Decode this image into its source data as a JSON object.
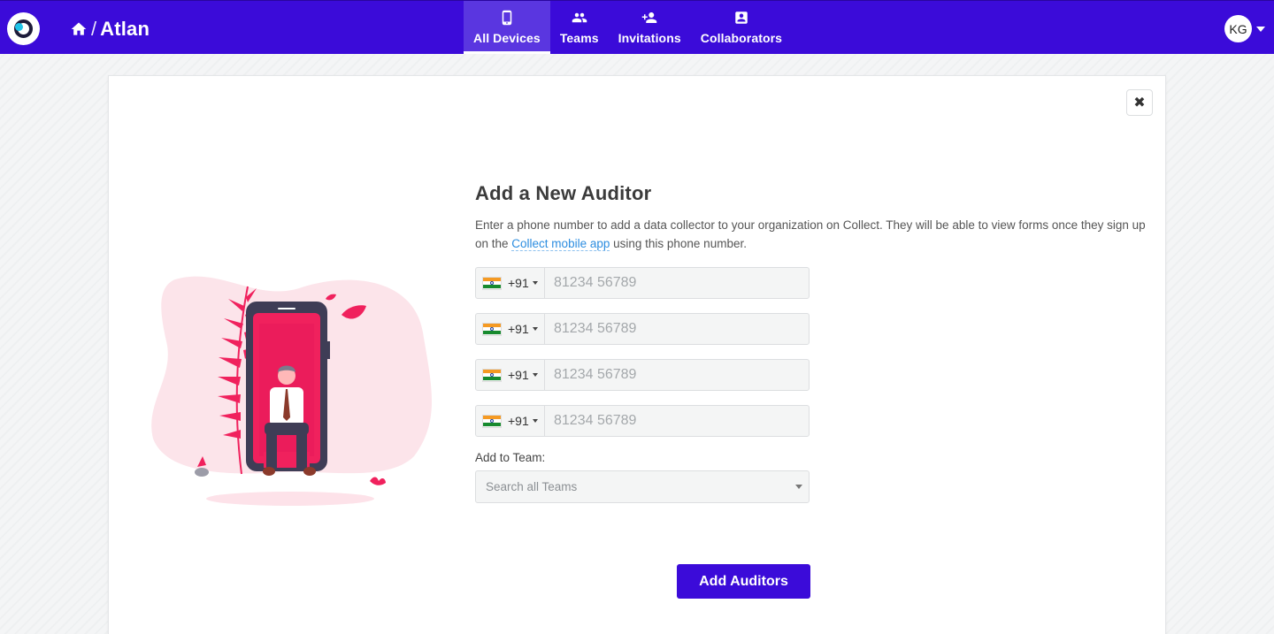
{
  "header": {
    "org_name": "Atlan",
    "breadcrumb_separator": "/",
    "nav": [
      {
        "label": "All Devices",
        "icon": "phone-icon",
        "active": true
      },
      {
        "label": "Teams",
        "icon": "people-icon",
        "active": false
      },
      {
        "label": "Invitations",
        "icon": "person-add-icon",
        "active": false
      },
      {
        "label": "Collaborators",
        "icon": "contact-card-icon",
        "active": false
      }
    ],
    "user_initials": "KG"
  },
  "modal": {
    "close_symbol": "✖",
    "title": "Add a New Auditor",
    "desc_before": "Enter a phone number to add a data collector to your organization on Collect. They will be able to view forms once they sign up on the ",
    "desc_link": "Collect mobile app",
    "desc_after": " using this phone number.",
    "phones": [
      {
        "country_code": "+91",
        "flag": "india-flag-icon",
        "placeholder": "81234 56789",
        "value": ""
      },
      {
        "country_code": "+91",
        "flag": "india-flag-icon",
        "placeholder": "81234 56789",
        "value": ""
      },
      {
        "country_code": "+91",
        "flag": "india-flag-icon",
        "placeholder": "81234 56789",
        "value": ""
      },
      {
        "country_code": "+91",
        "flag": "india-flag-icon",
        "placeholder": "81234 56789",
        "value": ""
      }
    ],
    "team_label": "Add to Team:",
    "team_placeholder": "Search all Teams",
    "submit_label": "Add Auditors"
  },
  "colors": {
    "brand": "#3b0bd9",
    "link": "#2c8de0",
    "illustration_accent": "#f0215d"
  }
}
